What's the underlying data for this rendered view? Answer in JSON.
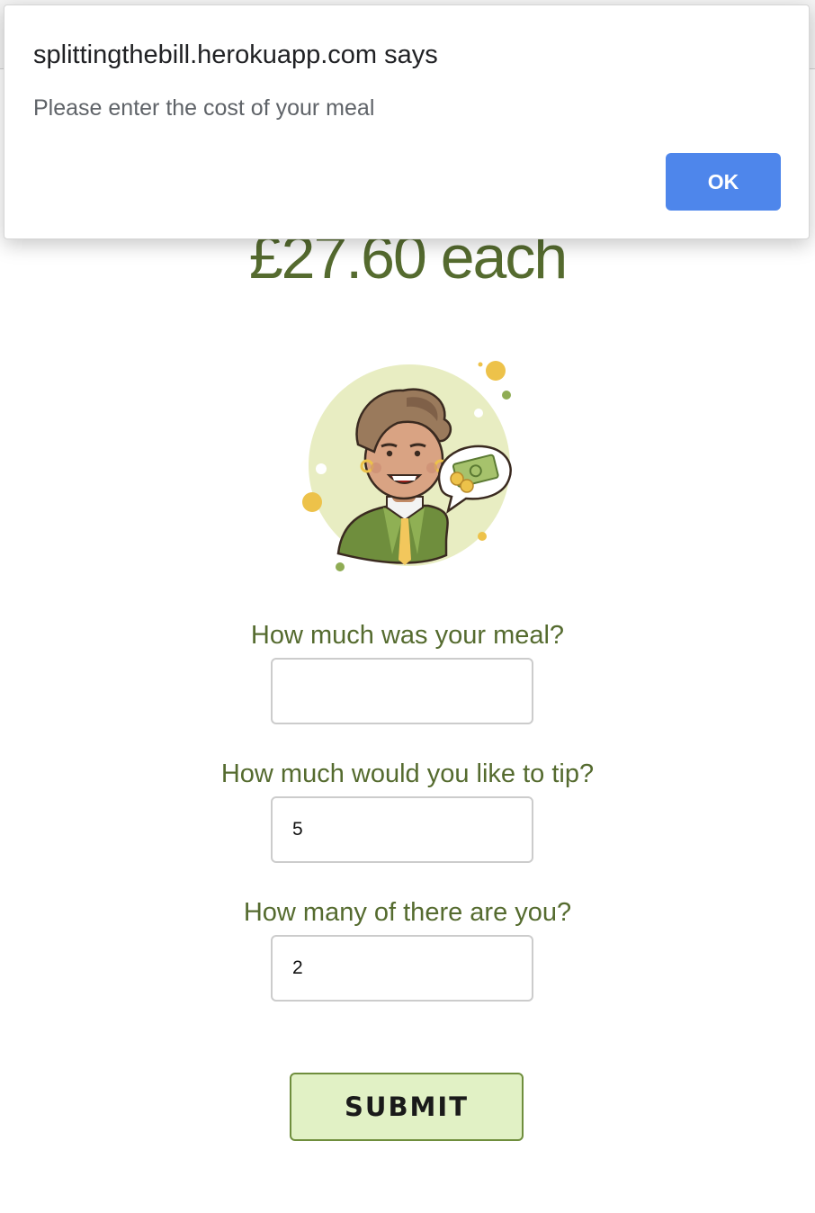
{
  "dialog": {
    "title": "splittingthebill.herokuapp.com says",
    "message": "Please enter the cost of your meal",
    "ok_label": "OK"
  },
  "result": {
    "text": "£27.60 each"
  },
  "form": {
    "meal_label": "How much was your meal?",
    "meal_value": "",
    "tip_label": "How much would you like to tip?",
    "tip_value": "5",
    "people_label": "How many of there are you?",
    "people_value": "2",
    "submit_label": "SUBMIT"
  },
  "colors": {
    "accent_text": "#556b2f",
    "dialog_button": "#4e86eb",
    "submit_fill": "#e1f1c5",
    "submit_border": "#6f8e3d"
  },
  "icons": {
    "illustration": "person-with-money-speech-bubble-icon"
  }
}
